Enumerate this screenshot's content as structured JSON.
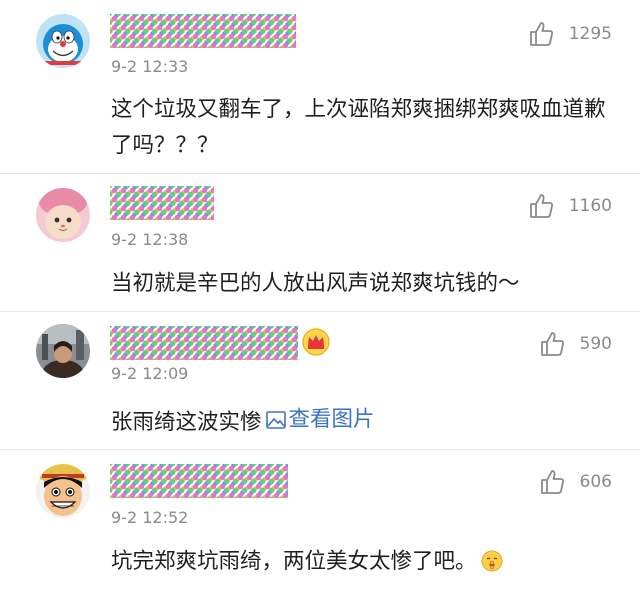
{
  "comments": [
    {
      "time": "9-2 12:33",
      "likes": "1295",
      "text": "这个垃圾又翻车了，上次诬陷郑爽捆绑郑爽吸血道歉了吗？？？"
    },
    {
      "time": "9-2 12:38",
      "likes": "1160",
      "text": "当初就是辛巴的人放出风声说郑爽坑钱的～"
    },
    {
      "time": "9-2 12:09",
      "likes": "590",
      "text": "张雨绮这波实惨",
      "link_text": "查看图片",
      "badge": "crown-icon"
    },
    {
      "time": "9-2 12:52",
      "likes": "606",
      "text": "坑完郑爽坑雨绮，两位美女太惨了吧。",
      "emoji": "shush-emoji"
    }
  ]
}
